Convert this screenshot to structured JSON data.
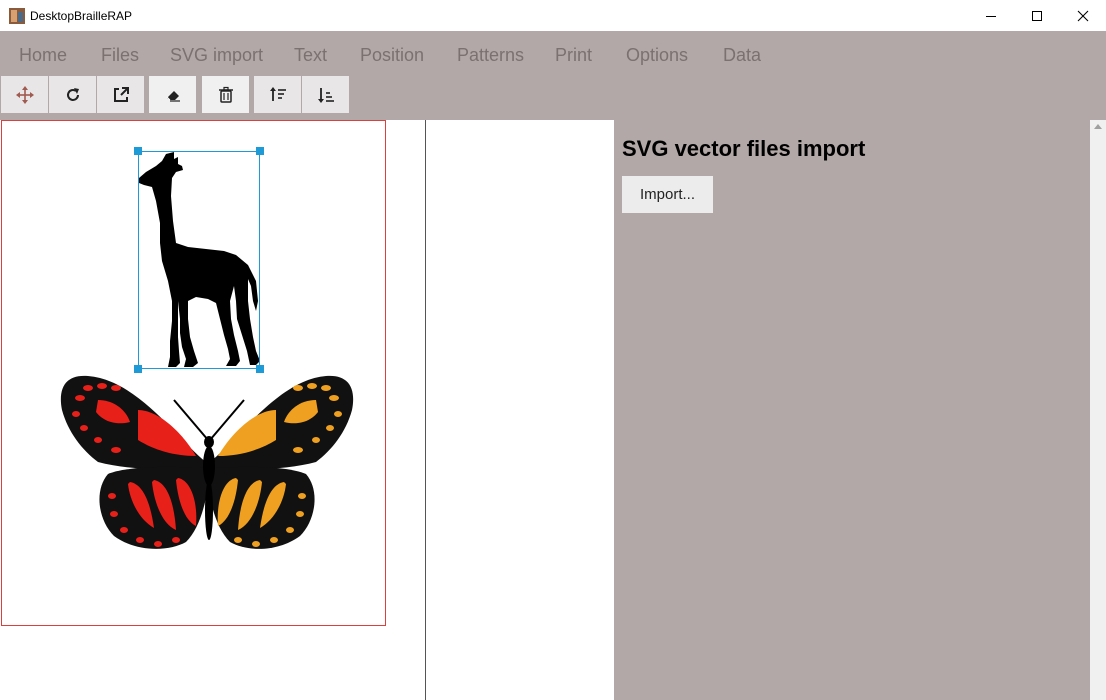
{
  "window": {
    "title": "DesktopBrailleRAP"
  },
  "menu": {
    "items": [
      {
        "label": "Home"
      },
      {
        "label": "Files"
      },
      {
        "label": "SVG import"
      },
      {
        "label": "Text"
      },
      {
        "label": "Position"
      },
      {
        "label": "Patterns"
      },
      {
        "label": "Print"
      },
      {
        "label": "Options"
      },
      {
        "label": "Data"
      }
    ]
  },
  "toolbar": {
    "buttons": [
      {
        "name": "move-tool-button",
        "icon": "move-icon"
      },
      {
        "name": "rotate-tool-button",
        "icon": "rotate-icon"
      },
      {
        "name": "export-tool-button",
        "icon": "external-link-icon"
      },
      {
        "name": "erase-tool-button",
        "icon": "eraser-icon"
      },
      {
        "name": "delete-tool-button",
        "icon": "trash-icon"
      },
      {
        "name": "sort-ascending-button",
        "icon": "sort-up-icon"
      },
      {
        "name": "sort-descending-button",
        "icon": "sort-down-icon"
      }
    ]
  },
  "panel": {
    "title": "SVG vector files import",
    "import_label": "Import..."
  },
  "colors": {
    "menu_bg": "#b2a8a7",
    "menu_text": "#7a7170",
    "page_border": "#d94040",
    "selection": "#1e9ad6"
  }
}
